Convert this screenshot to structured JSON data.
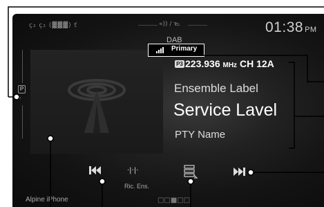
{
  "status_bar": {
    "icons_left": "ç₂ ç₂ (▓▓▓) ť",
    "icons_center": "«)) / ℡",
    "clock_time": "01:38",
    "clock_ampm": "PM"
  },
  "source_label": "DAB",
  "signal": {
    "label": "Primary"
  },
  "tuner": {
    "preset": "P3",
    "frequency": "223.936",
    "unit": "MHz",
    "channel": "CH 12A"
  },
  "labels": {
    "ensemble": "Ensemble Label",
    "service": "Service Lavel",
    "pty": "PTY Name"
  },
  "rail": {
    "preset_badge": "P",
    "search_icon": "⌕"
  },
  "controls": {
    "prev_icon": "⏮",
    "scan_icon": "·|·|·",
    "scan_label": "Ric. Ens.",
    "next_icon": "⏭"
  },
  "bottom": {
    "device_label": "Alpine iPhone",
    "page_dots": "□□■□□"
  }
}
